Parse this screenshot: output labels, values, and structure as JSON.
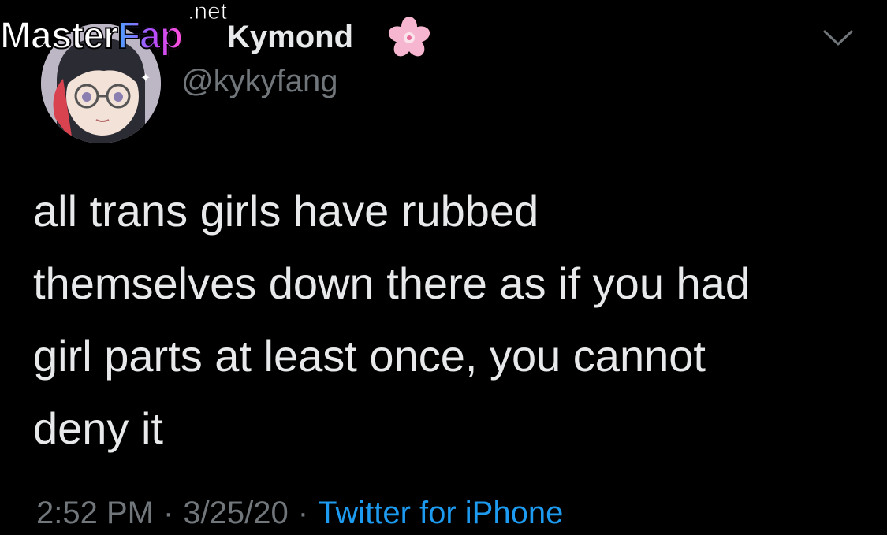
{
  "watermark": {
    "master": "Master",
    "fap": "Fap",
    "net": ".net"
  },
  "user": {
    "display_name": "Kymond",
    "handle": "@kykyfang",
    "name_emoji_icon": "cherry-blossom-icon"
  },
  "tweet": {
    "text": "all trans girls have rubbed\nthemselves down there as if you had\ngirl parts at least once, you cannot\ndeny it",
    "time": "2:52 PM",
    "date": "3/25/20",
    "separator": "·",
    "source": "Twitter for iPhone"
  },
  "icons": {
    "menu": "chevron-down-icon"
  },
  "colors": {
    "background": "#000000",
    "text": "#e7e9ea",
    "muted": "#71767b",
    "link": "#1d9bf0"
  }
}
